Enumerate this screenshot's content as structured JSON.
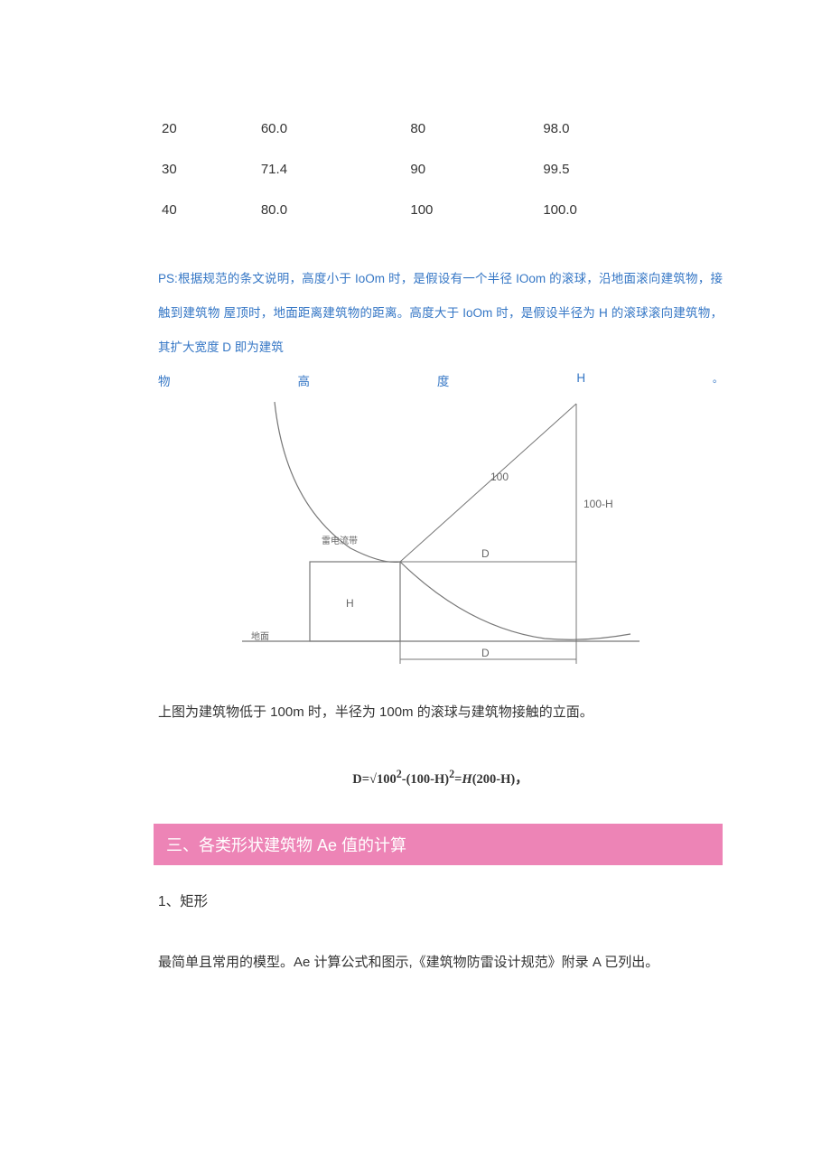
{
  "table": {
    "rows": [
      {
        "c1": "20",
        "c2": "60.0",
        "c3": "80",
        "c4": "98.0"
      },
      {
        "c1": "30",
        "c2": "71.4",
        "c3": "90",
        "c4": "99.5"
      },
      {
        "c1": "40",
        "c2": "80.0",
        "c3": "100",
        "c4": "100.0"
      }
    ]
  },
  "note": {
    "line1": "PS:根据规范的条文说明，高度小于 IoOm 时，是假设有一个半径 IOom 的滚球，沿地面滚向建筑物，接触到建筑物",
    "line2": "屋顶时，地面距离建筑物的距离。高度大于 IoOm 时，是假设半径为 H 的滚球滚向建筑物，其扩大宽度 D 即为建筑",
    "spread": {
      "a": "物",
      "b": "高",
      "c": "度",
      "d": "H",
      "e": "。"
    }
  },
  "diagram": {
    "labels": {
      "radius": "100",
      "height_diff": "100-H",
      "h_label": "H",
      "d_label_inner": "D",
      "d_label_bottom": "D",
      "ground": "地面",
      "lightning": "雷电流带"
    }
  },
  "caption": "上图为建筑物低于 100m 时，半径为 100m 的滚球与建筑物接触的立面。",
  "formula": {
    "pre": "D=√100",
    "sup1": "2",
    "mid": "-(100-H)",
    "sup2": "2",
    "eq": "=",
    "italic": "H",
    "post": "(200-H)",
    "comma": "，"
  },
  "section_header": "三、各类形状建筑物 Ae 值的计算",
  "subhead": "1、矩形",
  "body": "最简单且常用的模型。Ae 计算公式和图示,《建筑物防雷设计规范》附录 A 已列出。"
}
